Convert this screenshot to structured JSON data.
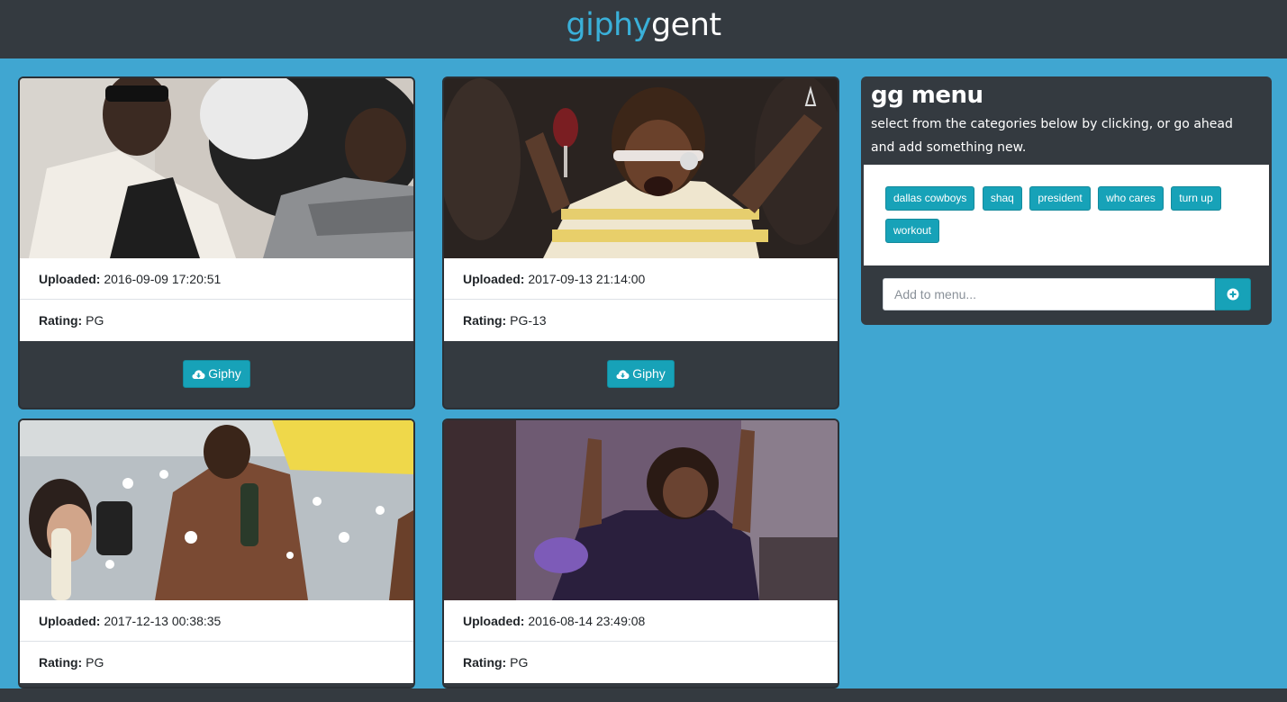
{
  "header": {
    "brand_part1": "giphy",
    "brand_part2": "gent"
  },
  "labels": {
    "uploaded": "Uploaded:",
    "rating": "Rating:"
  },
  "cards": [
    {
      "uploaded": "2016-09-09 17:20:51",
      "rating": "PG",
      "button": "Giphy"
    },
    {
      "uploaded": "2017-09-13 21:14:00",
      "rating": "PG-13",
      "button": "Giphy"
    },
    {
      "uploaded": "2017-12-13 00:38:35",
      "rating": "PG"
    },
    {
      "uploaded": "2016-08-14 23:49:08",
      "rating": "PG"
    }
  ],
  "menu": {
    "title": "gg menu",
    "description": "select from the categories below by clicking, or go ahead and add something new.",
    "tags": [
      "dallas cowboys",
      "shaq",
      "president",
      "who cares",
      "turn up",
      "workout"
    ],
    "input_placeholder": "Add to menu...",
    "add_icon": "plus-circle-icon"
  },
  "colors": {
    "background": "#40a6d1",
    "dark": "#343a40",
    "accent": "#17a2b8",
    "brand_blue": "#3ab0d9"
  },
  "icons": {
    "button_icon": "cloud-download-icon",
    "watermark_icon": "giphy-watermark-icon"
  }
}
